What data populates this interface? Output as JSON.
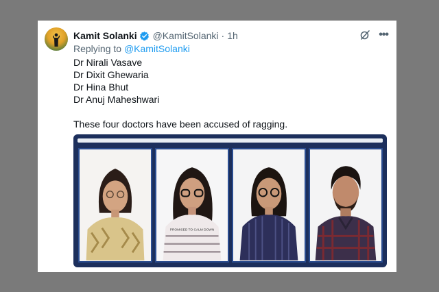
{
  "tweet": {
    "author_name": "Kamit Solanki",
    "handle": "@KamitSolanki",
    "separator": "·",
    "time": "1h",
    "replying_prefix": "Replying to",
    "replying_to": "@KamitSolanki",
    "lines": [
      "Dr Nirali Vasave",
      "Dr Dixit Ghewaria",
      "Dr Hina Bhut",
      "Dr Anuj Maheshwari"
    ],
    "body": "These four doctors have been accused of ragging.",
    "more_icon": "more-horizontal-icon",
    "grok_icon": "grok-icon",
    "verified_icon": "verified-badge-icon"
  },
  "media": {
    "shirt_text": "PROMISED TO CALM DOWN",
    "colors": {
      "frame": "#1c2f5c",
      "border": "#2a4c8f",
      "verified": "#1d9bf0",
      "link": "#1d9bf0"
    }
  }
}
